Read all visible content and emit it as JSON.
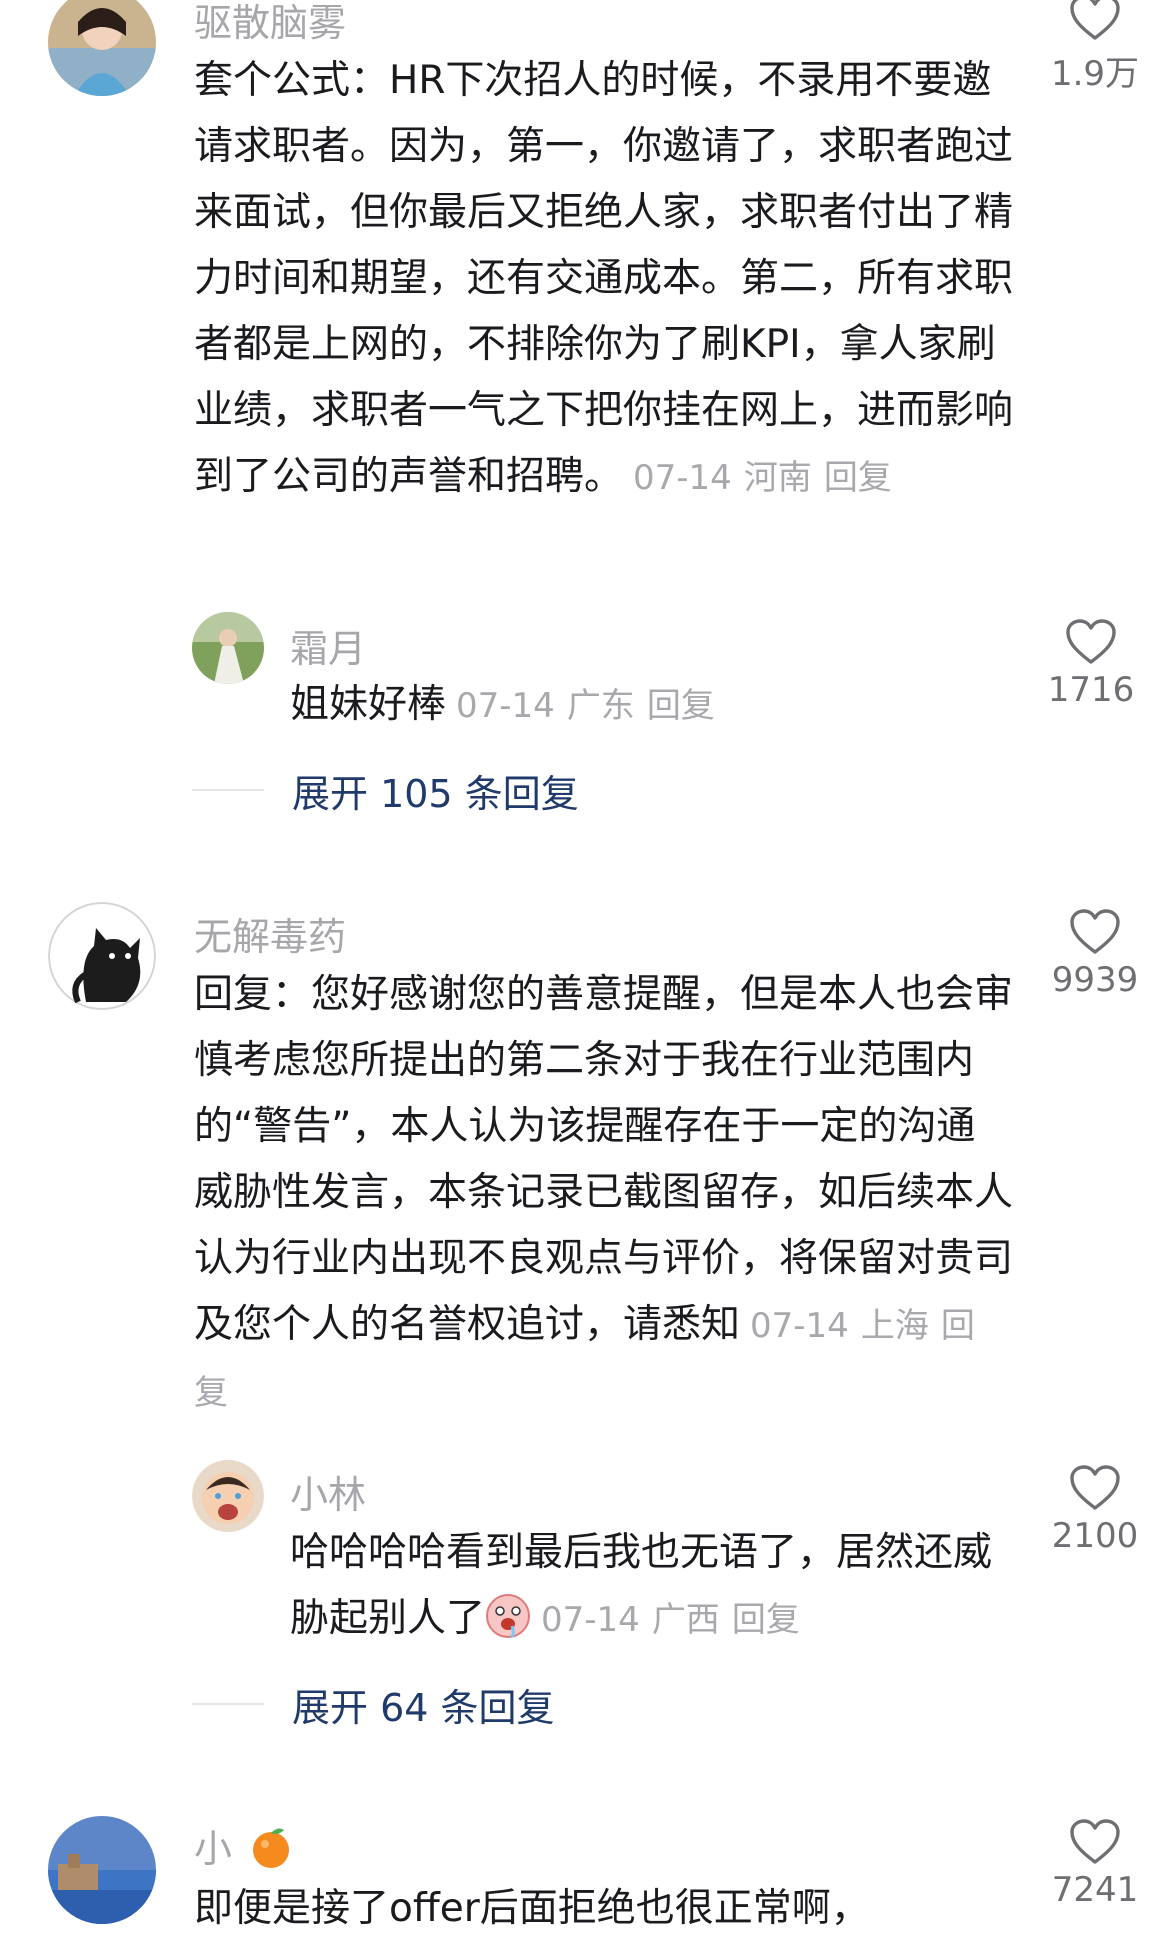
{
  "comments": [
    {
      "username": "驱散脑雾",
      "text": "套个公式：HR下次招人的时候，不录用不要邀请求职者。因为，第一，你邀请了，求职者跑过来面试，但你最后又拒绝人家，求职者付出了精力时间和期望，还有交通成本。第二，所有求职者都是上网的，不排除你为了刷KPI，拿人家刷业绩，求职者一气之下把你挂在网上，进而影响到了公司的声誉和招聘。",
      "date": "07-14",
      "location": "河南",
      "reply_label": "回复",
      "likes": "1.9万",
      "replies": [
        {
          "username": "霜月",
          "text": "姐妹好棒",
          "date": "07-14",
          "location": "广东",
          "reply_label": "回复",
          "likes": "1716"
        }
      ],
      "expand_label": "展开 105 条回复"
    },
    {
      "username": "无解毒药",
      "text": "回复：您好感谢您的善意提醒，但是本人也会审慎考虑您所提出的第二条对于我在行业范围内的“警告”，本人认为该提醒存在于一定的沟通威胁性发言，本条记录已截图留存，如后续本人认为行业内出现不良观点与评价，将保留对贵司及您个人的名誉权追讨，请悉知",
      "date": "07-14",
      "location": "上海",
      "reply_label": "回复",
      "likes": "9939",
      "replies": [
        {
          "username": "小林",
          "text": "哈哈哈哈看到最后我也无语了，居然还威胁起别人了",
          "emoji": "drooling-face-emoji",
          "date": "07-14",
          "location": "广西",
          "reply_label": "回复",
          "likes": "2100"
        }
      ],
      "expand_label": "展开 64 条回复"
    },
    {
      "username": "小",
      "username_emoji": "orange-emoji",
      "text": "即便是接了offer后面拒绝也很正常啊，",
      "likes": "7241"
    }
  ],
  "colors": {
    "username": "#a6a6ab",
    "text": "#1b1b1f",
    "meta": "#a8a8ad",
    "expand": "#1f3a6b",
    "heart_stroke": "#6e6e73"
  }
}
